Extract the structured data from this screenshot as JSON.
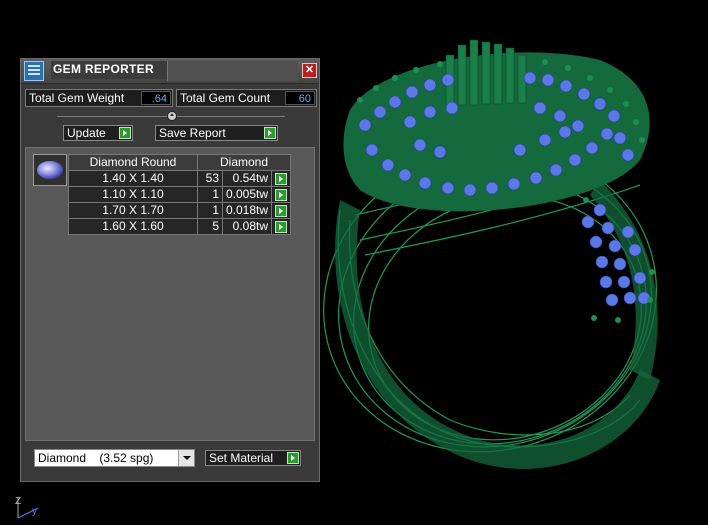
{
  "panel": {
    "title": "GEM REPORTER",
    "close_glyph": "✕",
    "total_gem_weight_label": "Total Gem Weight",
    "total_gem_weight_value": ".64",
    "total_gem_count_label": "Total Gem Count",
    "total_gem_count_value": "60",
    "update_label": "Update",
    "save_report_label": "Save Report",
    "gem_icon": "round-gem-icon",
    "table": {
      "headers": [
        "Diamond Round",
        "Diamond"
      ],
      "rows": [
        {
          "size": "1.40 X 1.40",
          "count": "53",
          "weight": "0.54tw"
        },
        {
          "size": "1.10 X 1.10",
          "count": "1",
          "weight": "0.005tw"
        },
        {
          "size": "1.70 X 1.70",
          "count": "1",
          "weight": "0.018tw"
        },
        {
          "size": "1.60 X 1.60",
          "count": "5",
          "weight": "0.08tw"
        }
      ]
    },
    "material_selected": "Diamond    (3.52 spg)",
    "set_material_label": "Set Material"
  },
  "axes": {
    "z": "Z",
    "y": "y"
  },
  "colors": {
    "ring_metal": "#1f8a55",
    "gem_stone": "#5a78e6",
    "value_text": "#49b6ff",
    "go_button": "#2c9a2c"
  }
}
